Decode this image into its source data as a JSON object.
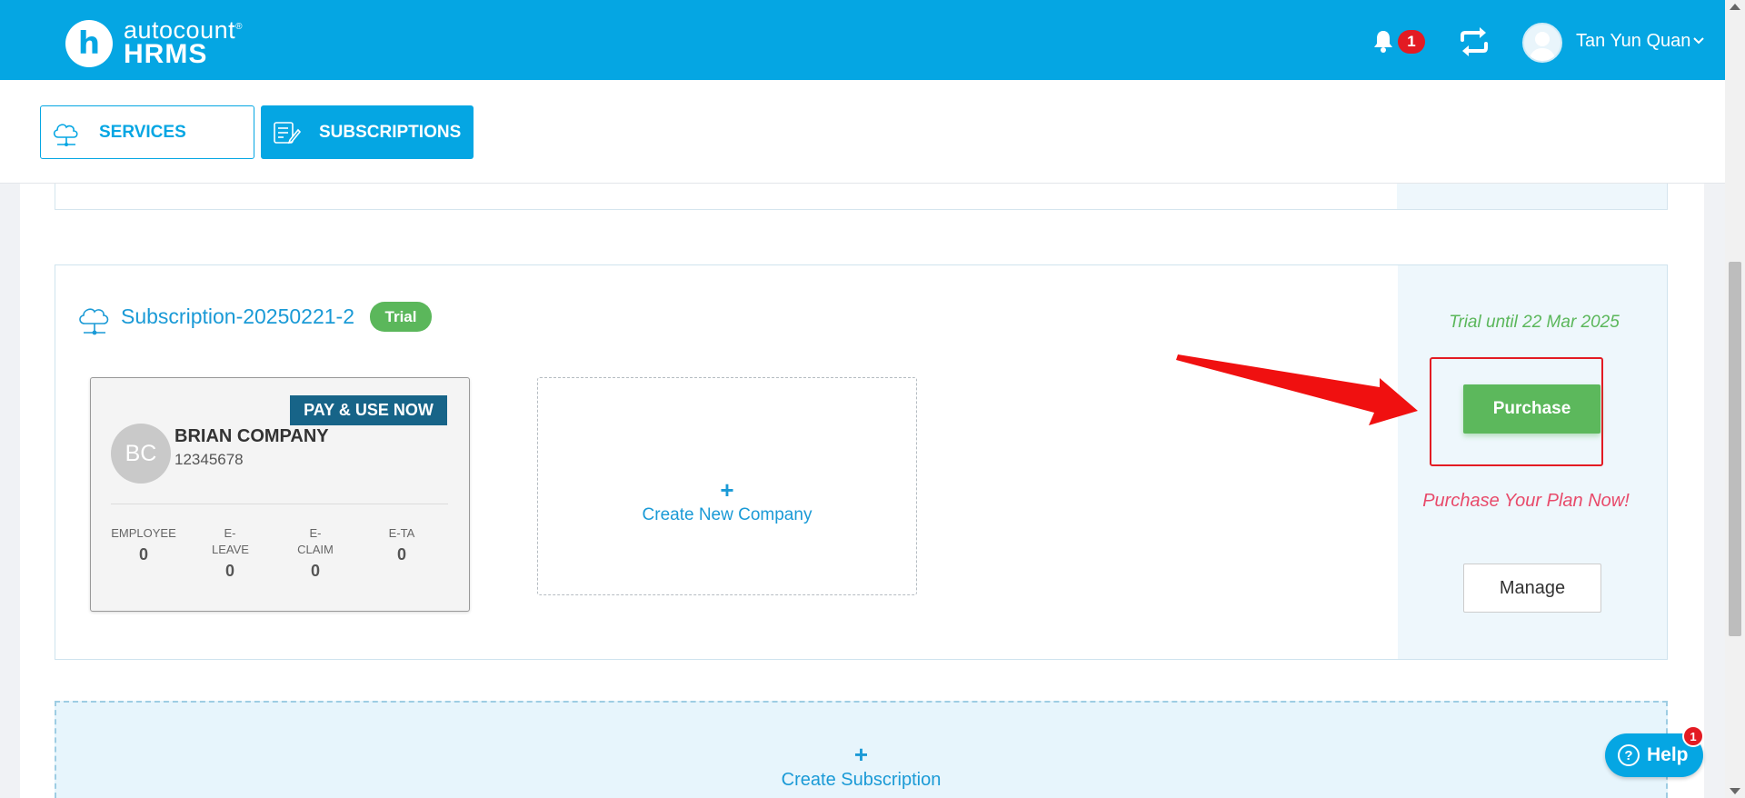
{
  "header": {
    "logo_mark": "h",
    "brand": "autocount",
    "brand_mark": "®",
    "product": "HRMS",
    "notification_count": "1",
    "user_name": "Tan Yun Quan"
  },
  "tabs": [
    {
      "label": "SERVICES"
    },
    {
      "label": "SUBSCRIPTIONS"
    }
  ],
  "subscription": {
    "name": "Subscription-20250221-2",
    "status": "Trial",
    "trial_until": "Trial until 22 Mar 2025",
    "purchase_label": "Purchase",
    "purchase_prompt": "Purchase Your Plan Now!",
    "manage_label": "Manage",
    "company": {
      "badge": "PAY & USE NOW",
      "initials": "BC",
      "name": "BRIAN COMPANY",
      "id": "12345678",
      "stats": [
        {
          "label": "EMPLOYEE",
          "value": "0"
        },
        {
          "label": "E-LEAVE",
          "value": "0"
        },
        {
          "label": "E-CLAIM",
          "value": "0"
        },
        {
          "label": "E-TA",
          "value": "0"
        }
      ]
    },
    "create_company": {
      "plus": "+",
      "label": "Create New Company"
    }
  },
  "create_subscription": {
    "plus": "+",
    "label": "Create Subscription"
  },
  "help": {
    "icon": "?",
    "label": "Help",
    "badge": "1"
  },
  "colors": {
    "accent": "#05a6e3",
    "success": "#5cb85c",
    "alert": "#e31b23"
  }
}
